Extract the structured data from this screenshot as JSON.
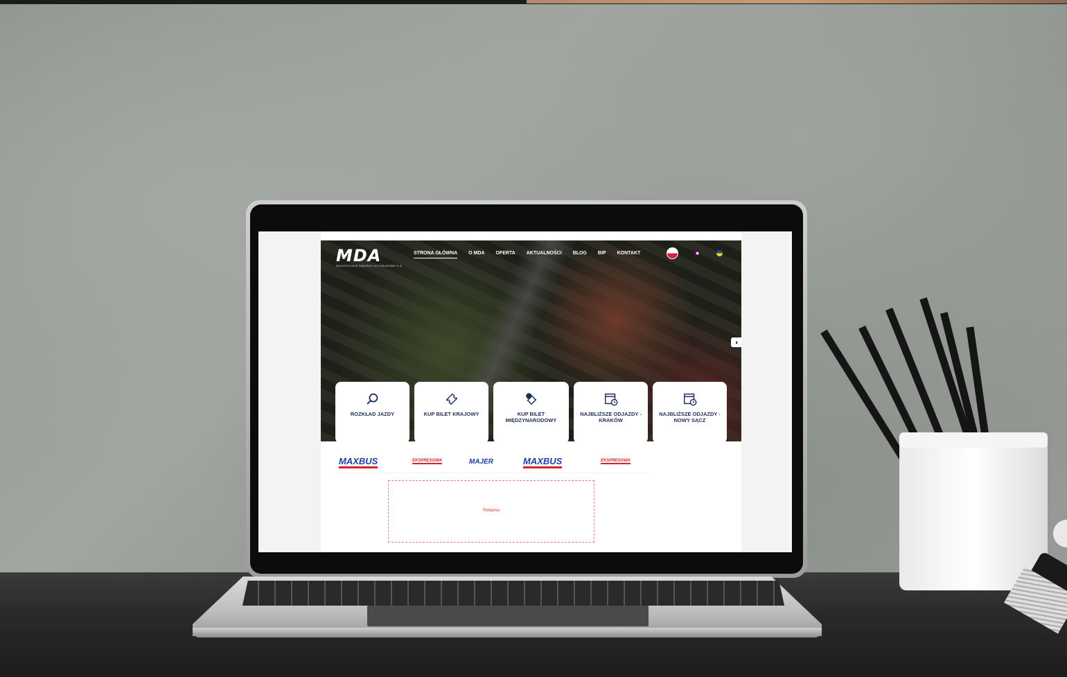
{
  "site": {
    "logo_text": "MDA",
    "logo_subtext": "MAŁOPOLSKIE DWORCE AUTOBUSOWE S.A."
  },
  "nav": {
    "items": [
      {
        "label": "STRONA GŁÓWNA",
        "active": true
      },
      {
        "label": "O MDA"
      },
      {
        "label": "OFERTA"
      },
      {
        "label": "AKTUALNOŚCI"
      },
      {
        "label": "BLOG"
      },
      {
        "label": "BIP"
      },
      {
        "label": "KONTAKT"
      }
    ]
  },
  "languages": {
    "items": [
      {
        "name": "polish-flag-icon",
        "color": "#d4213d"
      },
      {
        "name": "english-flag-icon",
        "color": "#c8102e"
      },
      {
        "name": "ukrainian-flag-icon",
        "color": "#0057b7"
      }
    ]
  },
  "contrast_toggle": {
    "icon": "contrast-icon",
    "glyph": "◑"
  },
  "tiles": {
    "items": [
      {
        "label": "ROZKŁAD JAZDY",
        "icon": "search-icon"
      },
      {
        "label": "KUP BILET KRAJOWY",
        "icon": "ticket-icon"
      },
      {
        "label": "KUP BILET MIĘDZYNARODOWY",
        "icon": "ticket-globe-icon"
      },
      {
        "label": "NAJBLIŻSZE ODJAZDY - KRAKÓW",
        "icon": "calendar-clock-icon"
      },
      {
        "label": "NAJBLIŻSZE ODJAZDY - NOWY SĄCZ",
        "icon": "calendar-clock-icon"
      }
    ]
  },
  "partners": {
    "items": [
      {
        "label": "MAXBUS",
        "kind": "maxbus"
      },
      {
        "label": "EKSPRESOWA",
        "kind": "ekspres"
      },
      {
        "label": "MAJER",
        "kind": "majer"
      },
      {
        "label": "MAXBUS",
        "kind": "maxbus"
      },
      {
        "label": "EKSPRESOWA",
        "kind": "ekspres"
      }
    ]
  },
  "ad": {
    "label": "Reklama"
  },
  "colors": {
    "tile_text": "#1f2f5a",
    "accent_red": "#d6252a",
    "partner_blue": "#1d3fa3"
  }
}
